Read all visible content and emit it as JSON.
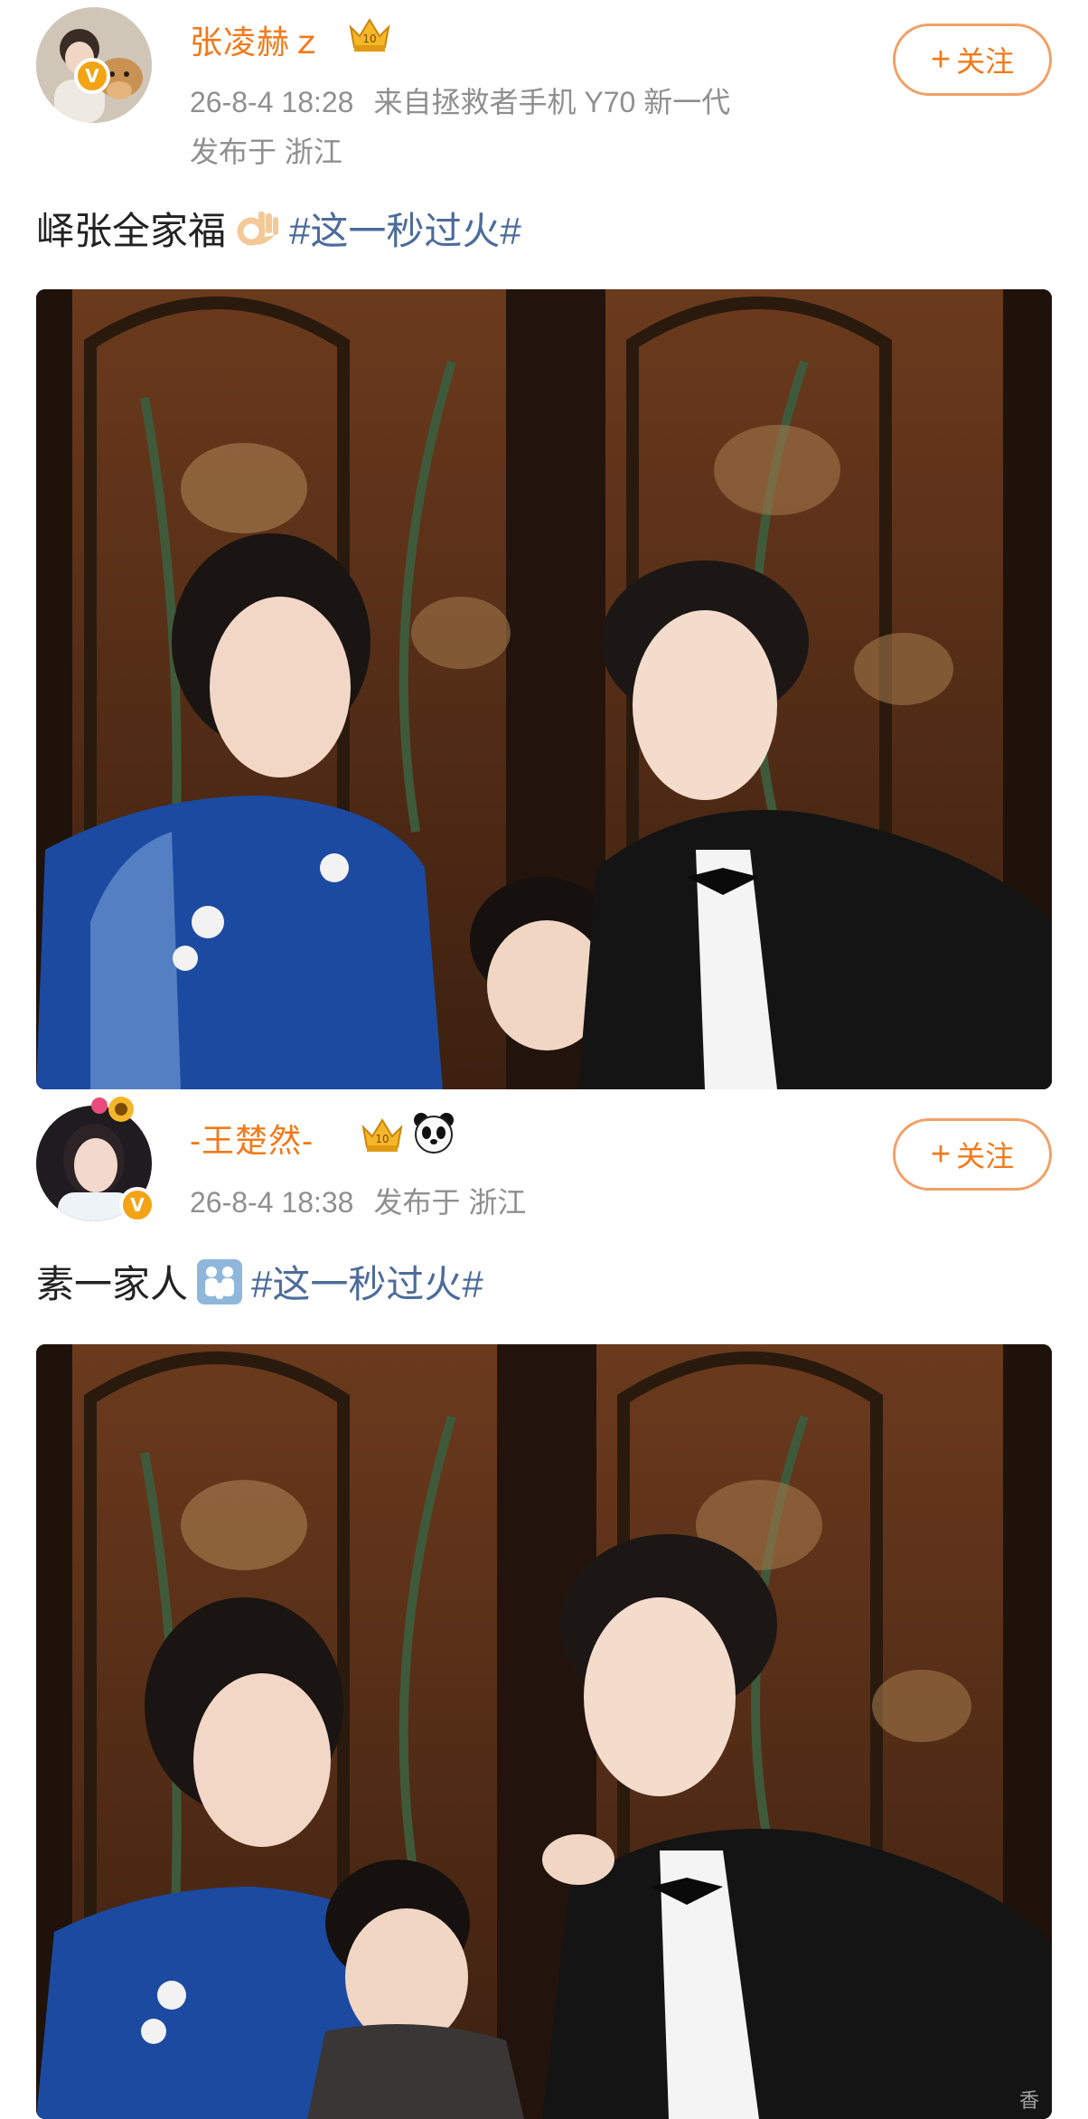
{
  "post1": {
    "username": "张凌赫ｚ",
    "timestamp": "26-8-4 18:28",
    "source": "来自拯救者手机 Y70 新一代",
    "location": "发布于 浙江",
    "follow_label": "关注",
    "text": "峄张全家福",
    "hashtag": "#这一秒过火#",
    "icons": {
      "avatar": "avatar-with-dog",
      "badge": "crown-badge-icon",
      "emoji": "ok-hand-emoji",
      "verified": "verified-v-icon"
    },
    "photo_alt": "family-portrait-photo"
  },
  "post2": {
    "username": "-王楚然-",
    "timestamp": "26-8-4 18:38",
    "location": "发布于 浙江",
    "follow_label": "关注",
    "text": "素一家人",
    "hashtag": "#这一秒过火#",
    "icons": {
      "avatar": "avatar-woman",
      "badge": "crown-badge-icon",
      "panda": "panda-emoji",
      "emoji": "family-emoji"
    },
    "photo_alt": "family-portrait-photo"
  },
  "watermark": "香",
  "colors": {
    "username": "#f2791a",
    "hashtag": "#4c6c9a",
    "follow_border": "#f2a067",
    "meta": "#8f8f8f"
  }
}
